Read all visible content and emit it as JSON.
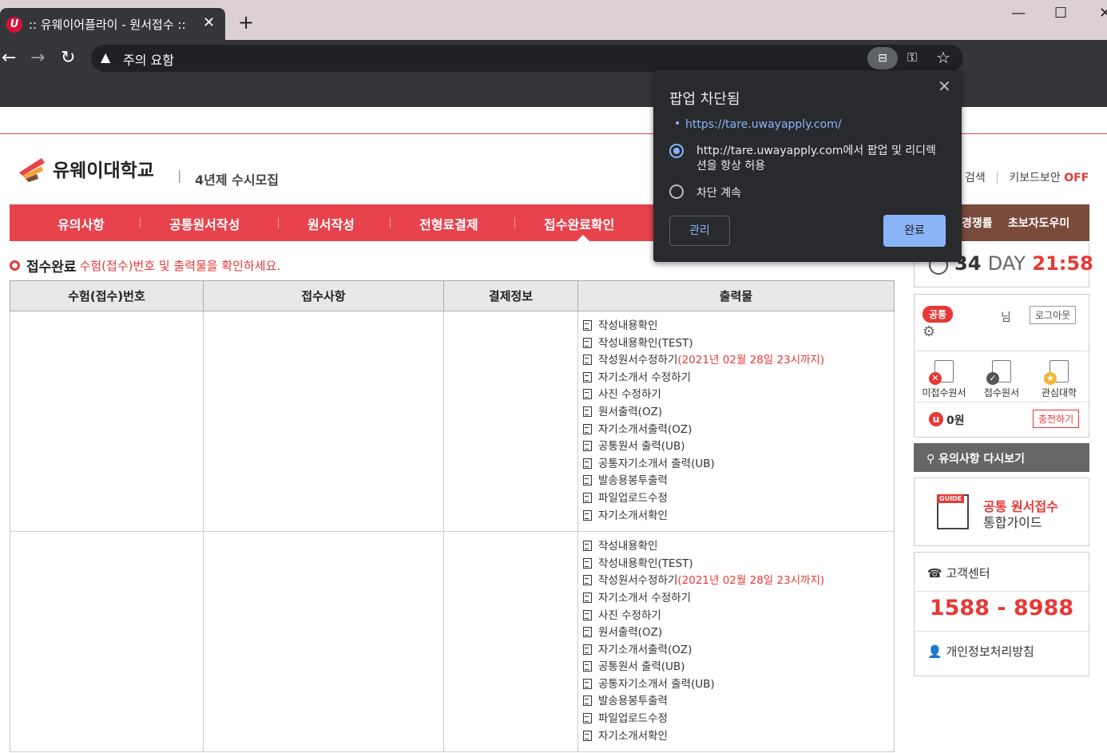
{
  "browser": {
    "tab_title": ":: 유웨이어플라이 - 원서접수 ::",
    "tab_favicon": "U",
    "tab_close": "✕",
    "new_tab": "+",
    "url_warning": "주의 요함",
    "window_controls": {
      "minimize": "—",
      "maximize": "☐",
      "close": "✕"
    }
  },
  "popup": {
    "title": "팝업 차단됨",
    "link": "https://tare.uwayapply.com/",
    "option_allow": "http://tare.uwayapply.com에서 팝업 및 리디렉션을 항상 허용",
    "option_block": "차단 계속",
    "selected_option": "allow",
    "manage_label": "관리",
    "done_label": "완료"
  },
  "header": {
    "logo_text": "유웨이대학교",
    "subtitle": "4년제 수시모집",
    "search_label": "검색",
    "keyboard_security_label": "키보드보안",
    "keyboard_security_state": "OFF"
  },
  "nav": {
    "items": [
      "유의사항",
      "공통원서작성",
      "원서작성",
      "전형료결제",
      "접수완료확인"
    ],
    "active_index": 4,
    "side_items": [
      "경쟁률",
      "초보자도우미"
    ]
  },
  "section": {
    "title": "접수완료",
    "description": "수험(접수)번호 및 출력물을 확인하세요."
  },
  "table": {
    "headers": [
      "수험(접수)번호",
      "접수사항",
      "결제정보",
      "출력물"
    ],
    "rows": [
      {
        "exam_no": "",
        "details": "",
        "payment": "",
        "outputs": [
          "작성내용확인",
          "작성내용확인(TEST)",
          "작성원서수정하기",
          "자기소개서 수정하기",
          "사진 수정하기",
          "원서출력(OZ)",
          "자기소개서출력(OZ)",
          "공통원서 출력(UB)",
          "공통자기소개서 출력(UB)",
          "발송용봉투출력",
          "파일업로드수정",
          "자기소개서확인"
        ],
        "deadline": "(2021년 02월 28일 23시까지)"
      },
      {
        "exam_no": "",
        "details": "",
        "payment": "",
        "outputs": [
          "작성내용확인",
          "작성내용확인(TEST)",
          "작성원서수정하기",
          "자기소개서 수정하기",
          "사진 수정하기",
          "원서출력(OZ)",
          "자기소개서출력(OZ)",
          "공통원서 출력(UB)",
          "공통자기소개서 출력(UB)",
          "발송용봉투출력",
          "파일업로드수정",
          "자기소개서확인"
        ],
        "deadline": "(2021년 02월 28일 23시까지)"
      }
    ]
  },
  "sidebar": {
    "dday_number": "34",
    "dday_unit": "DAY",
    "dday_time": "21:58",
    "badge_common": "공통",
    "nim": "님",
    "logout": "로그아웃",
    "quick_links": [
      "미접수원서",
      "접수원서",
      "관심대학"
    ],
    "points": "0원",
    "charge": "충전하기",
    "review_notice": "유의사항 다시보기",
    "guide_tag": "GUIDE",
    "guide_line1": "공통 원서접수",
    "guide_line2": "통합가이드",
    "cs_title": "고객센터",
    "cs_phone": "1588 - 8988",
    "privacy": "개인정보처리방침"
  },
  "colors": {
    "brand_red": "#e8424c",
    "side_brown": "#7a4a3a",
    "popup_bg": "#292a2d",
    "popup_accent": "#8ab4f8"
  }
}
